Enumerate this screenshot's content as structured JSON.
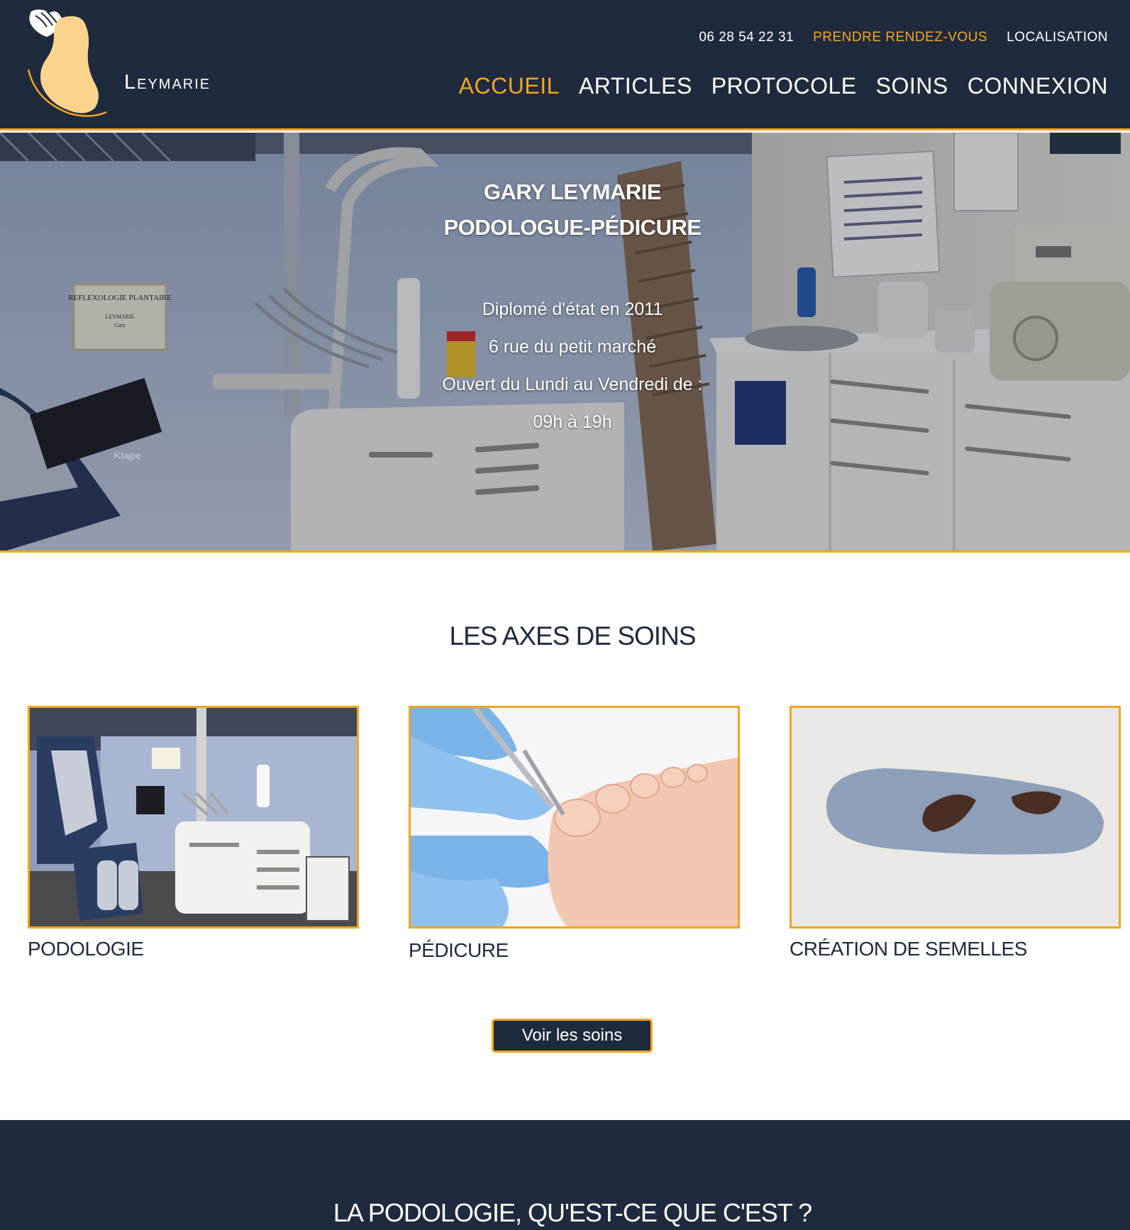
{
  "brand": {
    "name": "Leymarie"
  },
  "header": {
    "phone": "06 28 54 22 31",
    "appointment": "PRENDRE RENDEZ-VOUS",
    "location": "LOCALISATION",
    "nav": [
      "ACCUEIL",
      "ARTICLES",
      "PROTOCOLE",
      "SOINS",
      "CONNEXION"
    ]
  },
  "hero": {
    "title_line1": "GARY LEYMARIE",
    "title_line2": "PODOLOGUE-PÉDICURE",
    "info": [
      "Diplomé d'état en 2011",
      "6 rue du petit marché",
      "Ouvert du Lundi au Vendredi de :",
      "09h à 19h"
    ],
    "poster_title": "REFLEXOLOGIE PLANTAIRE",
    "poster_name": "LEYMARIE",
    "poster_sub": "Gary",
    "box_text": "Ktape"
  },
  "care": {
    "title": "LES AXES DE SOINS",
    "items": [
      {
        "label": "PODOLOGIE"
      },
      {
        "label": "PÉDICURE"
      },
      {
        "label": "CRÉATION DE SEMELLES"
      }
    ],
    "button": "Voir les soins"
  },
  "band": {
    "title": "LA PODOLOGIE, QU'EST-CE QUE C'EST ?"
  },
  "colors": {
    "navy": "#1f2a3c",
    "accent": "#f2a51f"
  }
}
